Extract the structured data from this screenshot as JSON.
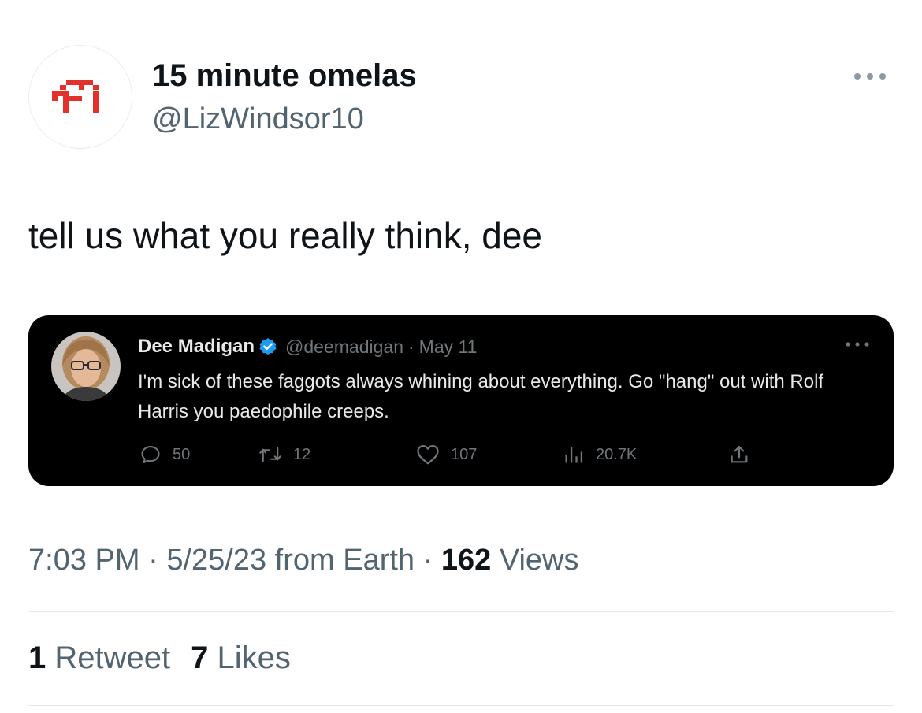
{
  "tweet": {
    "display_name": "15 minute omelas",
    "handle": "@LizWindsor10",
    "text": "tell us what you really think, dee",
    "time": "7:03 PM",
    "sep1": "·",
    "date": "5/25/23",
    "source": "from Earth",
    "sep2": "·",
    "views_count": "162",
    "views_label": "Views",
    "retweets_count": "1",
    "retweets_label": "Retweet",
    "likes_count": "7",
    "likes_label": "Likes"
  },
  "embedded_tweet": {
    "display_name": "Dee Madigan",
    "handle": "@deemadigan",
    "sep": "·",
    "date": "May 11",
    "text": "I'm sick of these faggots always whining about everything. Go \"hang\" out with Rolf Harris you paedophile creeps.",
    "replies": "50",
    "retweets": "12",
    "likes": "107",
    "views": "20.7K"
  },
  "icons": {
    "avatar": "pixel-glyph-icon",
    "more": "more-horizontal-icon",
    "verified": "verified-badge-icon",
    "reply": "reply-icon",
    "retweet": "retweet-icon",
    "like": "heart-icon",
    "views": "views-bar-icon",
    "share": "share-icon"
  },
  "colors": {
    "avatar_red": "#e4302b",
    "verified_blue": "#1d9bf0",
    "embed_bg": "#000000",
    "secondary_text": "#536471"
  }
}
